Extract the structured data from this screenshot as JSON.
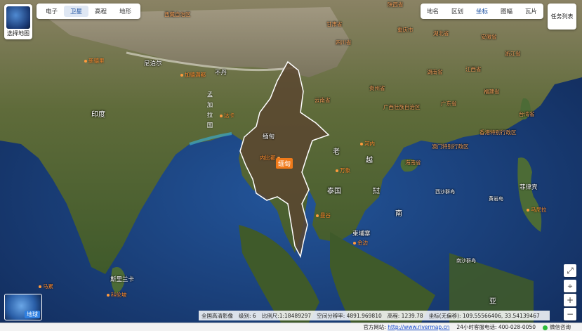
{
  "basemap_selector": {
    "label": "选择地图"
  },
  "layers": {
    "electronic": "电子",
    "satellite": "卫星",
    "elevation": "高程",
    "terrain": "地形"
  },
  "toolbar": {
    "items": [
      "地名",
      "区划",
      "坐标",
      "图幅",
      "瓦片"
    ]
  },
  "task_list": "任务列表",
  "globe": {
    "label": "地球"
  },
  "zoom": {
    "reset": "⌖",
    "plus": "+",
    "minus": "−",
    "fullscreen": "⤢"
  },
  "status": {
    "source": "全国高清影像",
    "level_label": "级别:",
    "level": "6",
    "scale_label": "比例尺:",
    "scale": "1:18489297",
    "resolution_label": "空间分辨率:",
    "resolution": "4891.969810",
    "elev_label": "高程:",
    "elev": "1239.78",
    "coord_label": "坐标(无偏移):",
    "coord": "109.55566406, 33.54139467"
  },
  "footer": {
    "site_label": "官方网站:",
    "site": "http://www.rivermap.cn",
    "hotline": "24小时客服电话: 400-028-0050",
    "wechat": "微信咨询"
  },
  "map": {
    "highlight": "缅甸",
    "capital": "内比都",
    "labels": {
      "nepal": "尼泊尔",
      "bhutan": "不丹",
      "bangladesh": [
        "孟",
        "加",
        "拉",
        "国"
      ],
      "india": "印度",
      "burma": "缅甸",
      "laos": "老",
      "vietnam": "越",
      "thailand": "泰国",
      "cambodia": "柬埔寨",
      "nan": "南",
      "philippines": "菲律宾",
      "srilanka": "斯里兰卡",
      "colombo": "科伦坡",
      "male": "马累",
      "vientiane": "万象",
      "hanoi": "河内",
      "bangkok": "曼谷",
      "phnompenh": "金边",
      "dhaka": "达卡",
      "kathmandu": "加德满都",
      "newdelhi": "新德里",
      "xisha": "西沙群岛",
      "huangyan": "黄岩岛",
      "sea": "亚",
      "nansha": "南沙群岛",
      "manila": "马尼拉",
      "ya": "亚"
    },
    "provinces": {
      "xizang": "西藏自治区",
      "qinghai": "青海省",
      "sichuan": "四川省",
      "chongqing": "重庆市",
      "hubei": "湖北省",
      "hunan": "湖南省",
      "jiangxi": "江西省",
      "zhejiang": "浙江省",
      "anhui": "安徽省",
      "fujian": "福建省",
      "guizhou": "贵州省",
      "yunnan": "云南省",
      "guangxi": "广西壮族自治区",
      "guangdong": "广东省",
      "hainan": "海南省",
      "hongkong": "香港特别行政区",
      "macao": "澳门特别行政区",
      "taiwan": "台湾省",
      "gansu": "甘肃省",
      "shaanxi": "陕西省"
    }
  },
  "colors": {
    "accent": "#1a4fa0",
    "highlight": "#f07a1a",
    "sea": "#1d3f7a"
  }
}
